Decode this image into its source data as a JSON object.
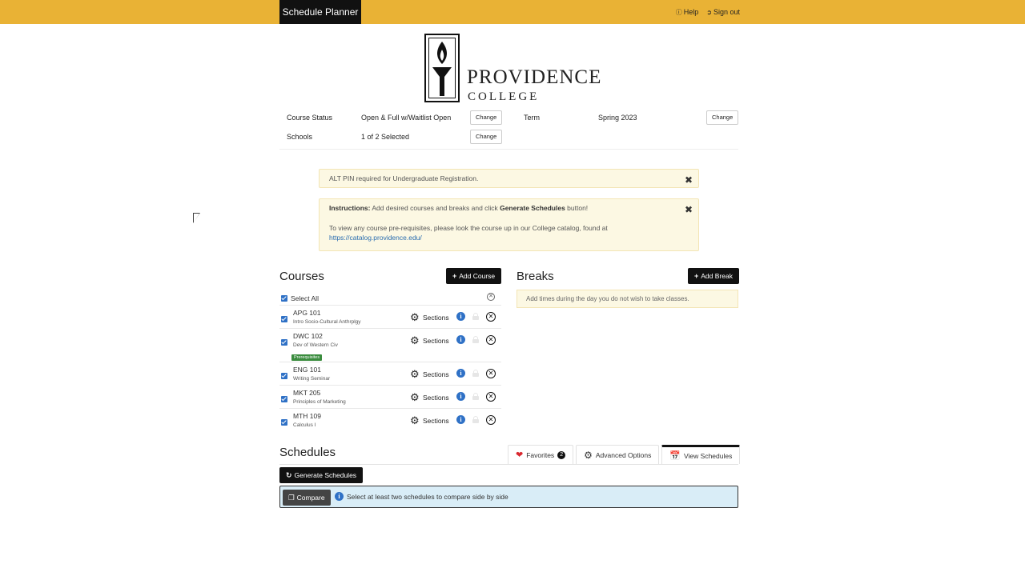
{
  "topbar": {
    "brand": "Schedule Planner",
    "help": "Help",
    "signout": "Sign out"
  },
  "logo": {
    "name": "PROVIDENCE",
    "sub": "COLLEGE"
  },
  "status": {
    "course_status_label": "Course Status",
    "course_status_value": "Open & Full w/Waitlist Open",
    "term_label": "Term",
    "term_value": "Spring 2023",
    "schools_label": "Schools",
    "schools_value": "1 of 2 Selected",
    "change": "Change"
  },
  "alerts": {
    "altpin": "ALT PIN required for Undergraduate Registration.",
    "instr_label": "Instructions:",
    "instr_text1": " Add desired courses and breaks and click ",
    "instr_bold": "Generate Schedules",
    "instr_text2": " button!",
    "prereq_text": "To view any course pre-requisites, please look the course up in our College catalog, found at",
    "catalog_link": "https://catalog.providence.edu/"
  },
  "courses": {
    "heading": "Courses",
    "add_label": "Add Course",
    "select_all": "Select All",
    "sections_label": "Sections",
    "prereq_badge": "Prerequisites",
    "items": [
      {
        "code": "APG 101",
        "title": "Intro Socio-Cultural Anthrplgy"
      },
      {
        "code": "DWC 102",
        "title": "Dev of Western Civ"
      },
      {
        "code": "ENG 101",
        "title": "Writing Seminar"
      },
      {
        "code": "MKT 205",
        "title": "Principles of Marketing"
      },
      {
        "code": "MTH 109",
        "title": "Calculus I"
      }
    ]
  },
  "breaks": {
    "heading": "Breaks",
    "add_label": "Add Break",
    "note": "Add times during the day you do not wish to take classes."
  },
  "schedules": {
    "heading": "Schedules",
    "favorites": "Favorites",
    "favorites_count": "2",
    "advanced": "Advanced Options",
    "view": "View Schedules",
    "generate": "Generate Schedules",
    "compare": "Compare",
    "compare_msg": "Select at least two schedules to compare side by side"
  }
}
